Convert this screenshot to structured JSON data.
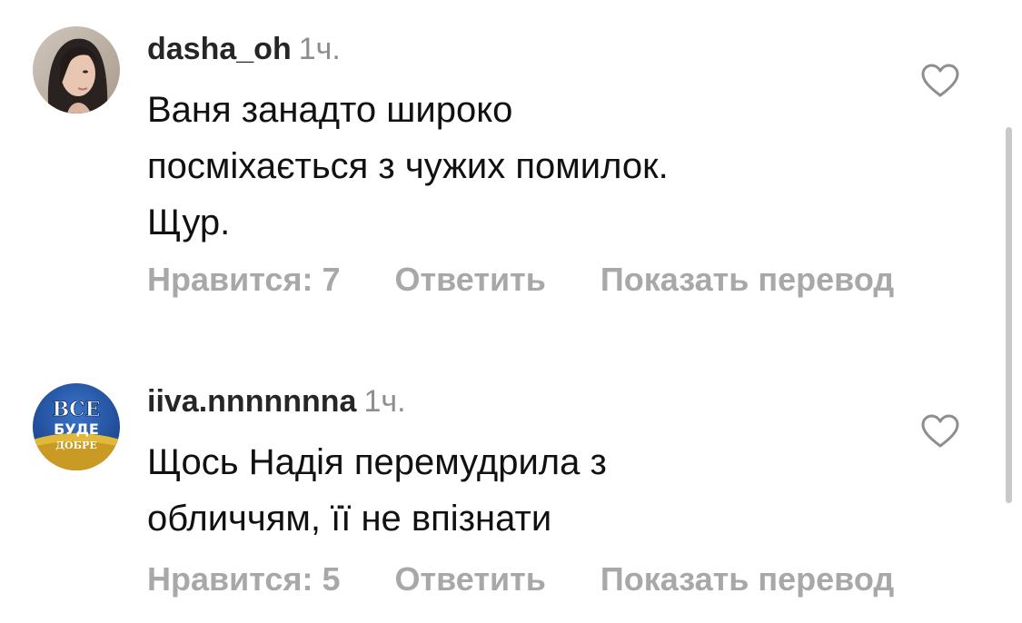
{
  "comments": [
    {
      "username": "dasha_oh",
      "time": "1ч.",
      "text_lines": [
        "Ваня занадто широко",
        "посміхається з чужих помилок.",
        "Щур."
      ],
      "likes_label": "Нравится: 7",
      "reply_label": "Ответить",
      "translate_label": "Показать перевод",
      "like_icon": "heart-outline-icon"
    },
    {
      "username": "iiva.nnnnnnna",
      "time": "1ч.",
      "text_lines": [
        "Щось Надія перемудрила з",
        "обличчям, її не впізнати"
      ],
      "likes_label": "Нравится: 5",
      "reply_label": "Ответить",
      "translate_label": "Показать перевод",
      "like_icon": "heart-outline-icon",
      "avatar_text": [
        "ВСЕ",
        "БУДЕ",
        "ДОБРЕ"
      ]
    }
  ],
  "colors": {
    "username": "#262626",
    "meta": "#8e8e8e",
    "actions": "#a8a8a8",
    "text": "#111111"
  }
}
